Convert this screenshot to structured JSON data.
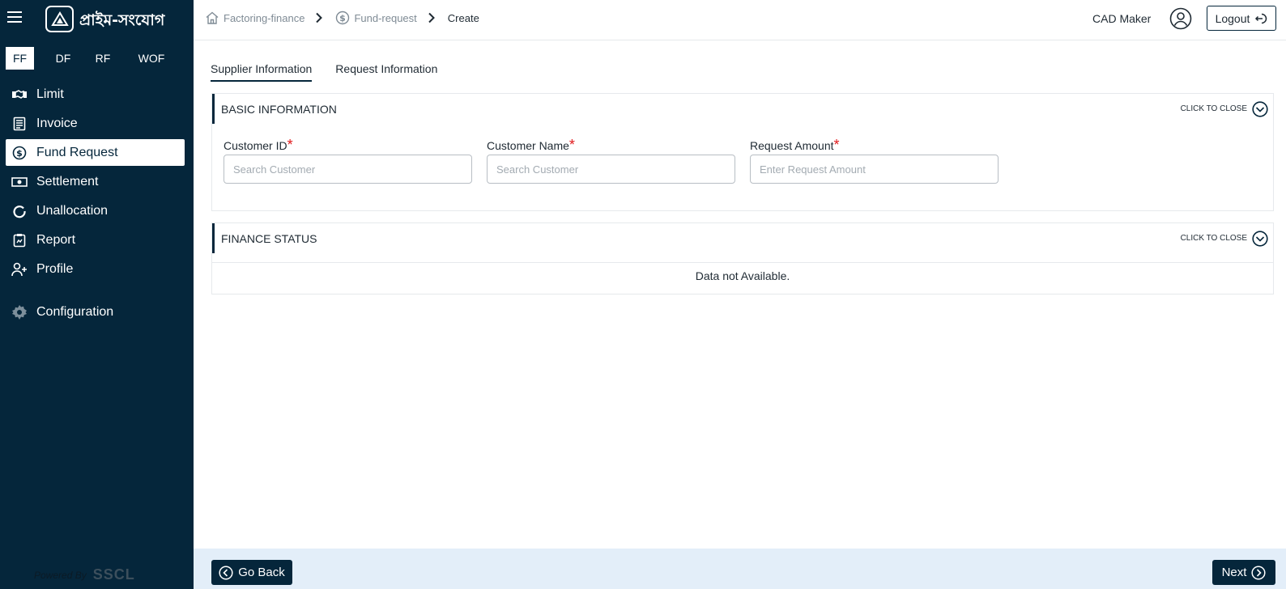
{
  "app": {
    "brand_name": "প্রাইম-সংযোগ"
  },
  "sidebar": {
    "type_tabs": [
      {
        "label": "FF",
        "active": true
      },
      {
        "label": "DF",
        "active": false
      },
      {
        "label": "RF",
        "active": false
      },
      {
        "label": "WOF",
        "active": false
      }
    ],
    "items": [
      {
        "label": "Limit",
        "icon": "handshake-icon"
      },
      {
        "label": "Invoice",
        "icon": "invoice-icon"
      },
      {
        "label": "Fund Request",
        "icon": "dollar-circle-icon",
        "active": true
      },
      {
        "label": "Settlement",
        "icon": "cash-icon"
      },
      {
        "label": "Unallocation",
        "icon": "circle-arrow-icon"
      },
      {
        "label": "Report",
        "icon": "clipboard-icon"
      },
      {
        "label": "Profile",
        "icon": "user-plus-icon"
      },
      {
        "label": "Configuration",
        "icon": "gear-icon"
      }
    ],
    "powered_by": "Powered By",
    "powered_brand": "SSCL"
  },
  "header": {
    "breadcrumb": [
      {
        "label": "Factoring-finance",
        "icon": "home-icon"
      },
      {
        "label": "Fund-request",
        "icon": "dollar-circle-icon"
      },
      {
        "label": "Create"
      }
    ],
    "user_name": "CAD Maker",
    "logout_label": "Logout"
  },
  "main": {
    "tabs": [
      {
        "label": "Supplier Information",
        "active": true
      },
      {
        "label": "Request Information",
        "active": false
      }
    ],
    "basic_info": {
      "title": "BASIC INFORMATION",
      "toggle_label": "CLICK TO CLOSE",
      "fields": [
        {
          "label": "Customer ID",
          "required_mark": "*",
          "placeholder": "Search Customer",
          "value": ""
        },
        {
          "label": "Customer Name",
          "required_mark": "*",
          "placeholder": "Search Customer",
          "value": ""
        },
        {
          "label": "Request Amount",
          "required_mark": "*",
          "placeholder": "Enter Request Amount",
          "value": ""
        }
      ]
    },
    "finance_status": {
      "title": "FINANCE STATUS",
      "toggle_label": "CLICK TO CLOSE",
      "empty_message": "Data not Available."
    }
  },
  "footer": {
    "back_label": "Go Back",
    "next_label": "Next"
  },
  "colors": {
    "sidebar_bg": "#05263b",
    "footer_bg": "#e3eef9",
    "required": "#e0191b"
  }
}
